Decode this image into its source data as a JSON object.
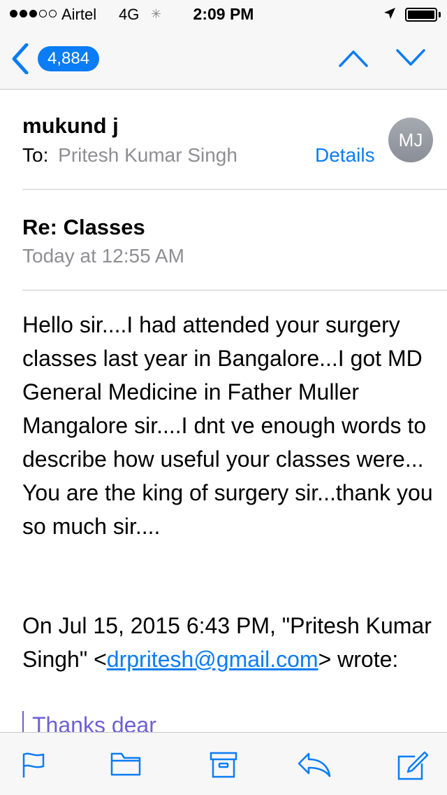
{
  "status_bar": {
    "carrier": "Airtel",
    "network": "4G",
    "time": "2:09 PM"
  },
  "nav": {
    "back_count": "4,884",
    "icons": [
      "chevron-left-icon",
      "chevron-up-icon",
      "chevron-down-icon"
    ]
  },
  "header": {
    "sender": "mukund j",
    "to_label": "To:",
    "to_name": "Pritesh Kumar Singh",
    "details_label": "Details",
    "avatar_initials": "MJ",
    "subject": "Re: Classes",
    "date": "Today at 12:55 AM"
  },
  "body": {
    "text": "Hello sir....I had attended your surgery classes last year in Bangalore...I got MD General Medicine in Father Muller Mangalore sir....I dnt ve enough words to describe how useful your classes were... You are the king of surgery sir...thank you so much sir....",
    "quote_intro_prefix": "On Jul 15, 2015 6:43 PM, \"Pritesh Kumar Singh\" <",
    "quote_email": "drpritesh@gmail.com",
    "quote_intro_suffix": "> wrote:",
    "quoted_text": "Thanks dear"
  },
  "toolbar": {
    "icons": [
      "flag-icon",
      "folder-icon",
      "archive-icon",
      "reply-icon",
      "compose-icon"
    ]
  },
  "colors": {
    "accent": "#0a7cf5",
    "secondary_text": "#8e8e93",
    "quote": "#6e5fd6",
    "bar_bg": "#f7f7f7"
  }
}
